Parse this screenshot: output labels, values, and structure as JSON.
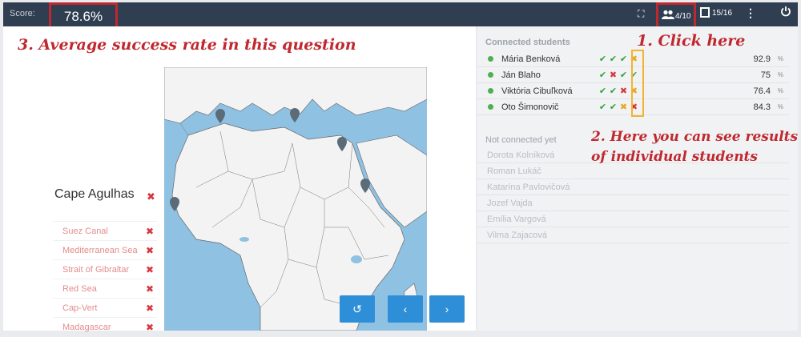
{
  "topbar": {
    "score_label": "Score:",
    "score_value": "78.6%",
    "students_count": "4/10",
    "slides_count": "15/16",
    "icons": {
      "fullscreen": "fullscreen-icon",
      "students": "users-icon",
      "slides": "slides-icon",
      "menu": "kebab-menu-icon",
      "power": "power-icon"
    }
  },
  "annotations": {
    "avg": "3. Average success rate in this question",
    "click": "1. Click here",
    "results_line1": "2. Here you can see results",
    "results_line2": "of individual students"
  },
  "question": {
    "title": "Cape Agulhas",
    "answers": [
      {
        "label": "Suez Canal"
      },
      {
        "label": "Mediterranean Sea"
      },
      {
        "label": "Strait of Gibraltar"
      },
      {
        "label": "Red Sea"
      },
      {
        "label": "Cap-Vert"
      },
      {
        "label": "Madagascar"
      }
    ]
  },
  "nav": {
    "reset": "↺",
    "prev": "‹",
    "next": "›"
  },
  "connected": {
    "title": "Connected students",
    "students": [
      {
        "name": "Mária Benková",
        "results": [
          "ok",
          "ok",
          "ok",
          "partial"
        ],
        "percent": "92.9",
        "unit": "%"
      },
      {
        "name": "Ján Blaho",
        "results": [
          "ok",
          "bad",
          "ok",
          "ok"
        ],
        "percent": "75",
        "unit": "%"
      },
      {
        "name": "Viktória Cibuľková",
        "results": [
          "ok",
          "ok",
          "bad",
          "partial"
        ],
        "percent": "76.4",
        "unit": "%"
      },
      {
        "name": "Oto Šimonovič",
        "results": [
          "ok",
          "ok",
          "partial",
          "bad"
        ],
        "percent": "84.3",
        "unit": "%"
      }
    ]
  },
  "not_connected": {
    "title": "Not connected yet",
    "students": [
      "Dorota Kolníková",
      "Roman Lukáč",
      "Katarína Pavlovičová",
      "Jozef Vajda",
      "Emília Vargová",
      "Vilma Zajacová"
    ]
  },
  "colors": {
    "topbar": "#2f3e51",
    "annotation": "#c0282f",
    "highlight": "#f2b42f",
    "nav_button": "#2e8fd8"
  }
}
